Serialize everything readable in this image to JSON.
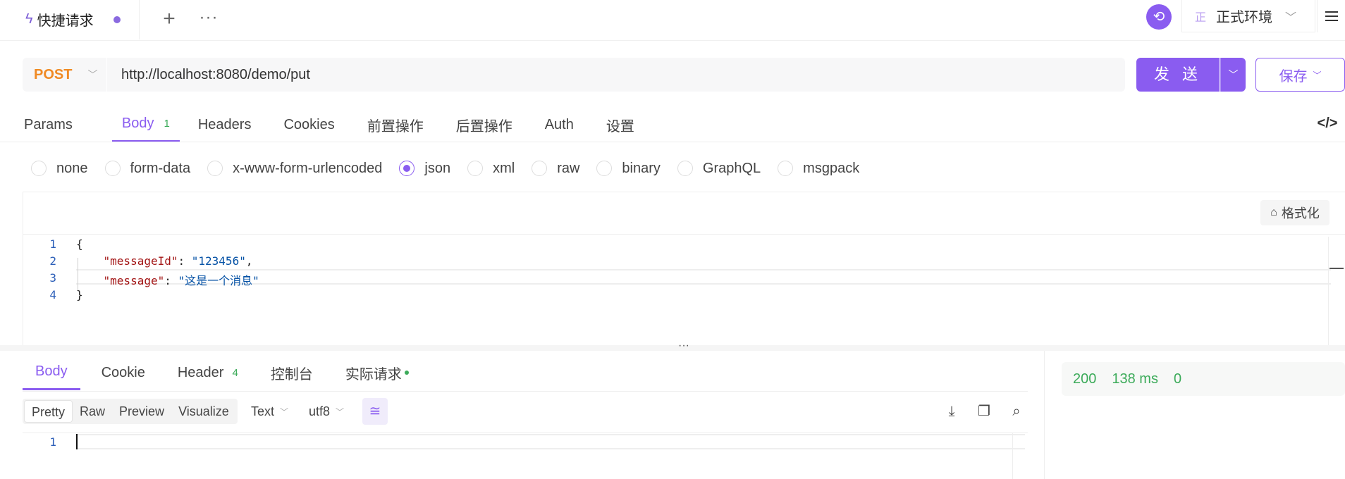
{
  "tab": {
    "title": "快捷请求"
  },
  "env": {
    "badge": "正",
    "name": "正式环境"
  },
  "request": {
    "method": "POST",
    "url": "http://localhost:8080/demo/put",
    "send_label": "发 送",
    "save_label": "保存"
  },
  "request_tabs": [
    {
      "label": "Params"
    },
    {
      "label": "Body",
      "count": "1"
    },
    {
      "label": "Headers"
    },
    {
      "label": "Cookies"
    },
    {
      "label": "前置操作"
    },
    {
      "label": "后置操作"
    },
    {
      "label": "Auth"
    },
    {
      "label": "设置"
    }
  ],
  "body_types": [
    "none",
    "form-data",
    "x-www-form-urlencoded",
    "json",
    "xml",
    "raw",
    "binary",
    "GraphQL",
    "msgpack"
  ],
  "body_type_selected": "json",
  "format_label": "格式化",
  "editor": {
    "line_numbers": [
      "1",
      "2",
      "3",
      "4"
    ],
    "open_brace": "{",
    "close_brace": "}",
    "key1": "\"messageId\"",
    "val1": "\"123456\"",
    "key2": "\"message\"",
    "val2": "\"这是一个消息\""
  },
  "response_tabs": [
    {
      "label": "Body"
    },
    {
      "label": "Cookie"
    },
    {
      "label": "Header",
      "count": "4"
    },
    {
      "label": "控制台"
    },
    {
      "label": "实际请求"
    }
  ],
  "view_modes": [
    "Pretty",
    "Raw",
    "Preview",
    "Visualize"
  ],
  "text_type": "Text",
  "encoding": "utf8",
  "response_line": "1",
  "status": {
    "code": "200",
    "time": "138 ms",
    "size": "0"
  },
  "colors": {
    "accent": "#8a5cf0",
    "method": "#f08a24",
    "success": "#3cab5a"
  }
}
